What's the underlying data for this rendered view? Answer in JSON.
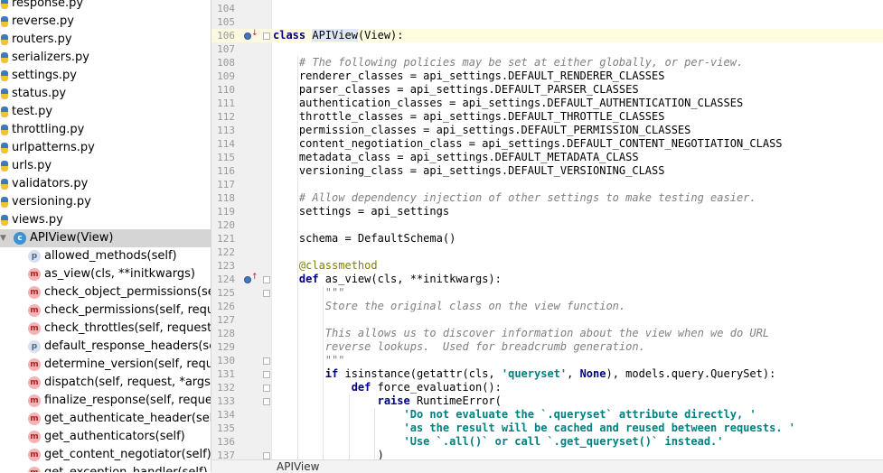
{
  "project_tree": {
    "files": [
      "response.py",
      "reverse.py",
      "routers.py",
      "serializers.py",
      "settings.py",
      "status.py",
      "test.py",
      "throttling.py",
      "urlpatterns.py",
      "urls.py",
      "validators.py",
      "versioning.py",
      "views.py"
    ],
    "class_node": {
      "badge": "c",
      "label": "APIView(View)"
    },
    "members": [
      {
        "badge": "p",
        "label": "allowed_methods(self)"
      },
      {
        "badge": "m",
        "label": "as_view(cls, **initkwargs)"
      },
      {
        "badge": "m",
        "label": "check_object_permissions(sel"
      },
      {
        "badge": "m",
        "label": "check_permissions(self, reque"
      },
      {
        "badge": "m",
        "label": "check_throttles(self, request)"
      },
      {
        "badge": "p",
        "label": "default_response_headers(sel"
      },
      {
        "badge": "m",
        "label": "determine_version(self, reque"
      },
      {
        "badge": "m",
        "label": "dispatch(self, request, *args,"
      },
      {
        "badge": "m",
        "label": "finalize_response(self, reques"
      },
      {
        "badge": "m",
        "label": "get_authenticate_header(self,"
      },
      {
        "badge": "m",
        "label": "get_authenticators(self)"
      },
      {
        "badge": "m",
        "label": "get_content_negotiator(self)"
      },
      {
        "badge": "m",
        "label": "get_exception_handler(self)"
      }
    ]
  },
  "editor": {
    "line_numbers": [
      "104",
      "105",
      "106",
      "107",
      "108",
      "109",
      "110",
      "111",
      "112",
      "113",
      "114",
      "115",
      "116",
      "117",
      "118",
      "119",
      "120",
      "121",
      "122",
      "123",
      "124",
      "125",
      "126",
      "127",
      "128",
      "129",
      "130",
      "131",
      "132",
      "133",
      "134",
      "135",
      "136",
      "137"
    ],
    "lines": {
      "l106_kw": "class ",
      "l106_name": "APIView",
      "l106_rest": "(View):",
      "l108": "    # The following policies may be set at either globally, or per-view.",
      "l109": "    renderer_classes = api_settings.DEFAULT_RENDERER_CLASSES",
      "l110": "    parser_classes = api_settings.DEFAULT_PARSER_CLASSES",
      "l111": "    authentication_classes = api_settings.DEFAULT_AUTHENTICATION_CLASSES",
      "l112": "    throttle_classes = api_settings.DEFAULT_THROTTLE_CLASSES",
      "l113": "    permission_classes = api_settings.DEFAULT_PERMISSION_CLASSES",
      "l114": "    content_negotiation_class = api_settings.DEFAULT_CONTENT_NEGOTIATION_CLASS",
      "l115": "    metadata_class = api_settings.DEFAULT_METADATA_CLASS",
      "l116": "    versioning_class = api_settings.DEFAULT_VERSIONING_CLASS",
      "l118": "    # Allow dependency injection of other settings to make testing easier.",
      "l119": "    settings = api_settings",
      "l121": "    schema = DefaultSchema()",
      "l123": "    @classmethod",
      "l124_kw": "    def ",
      "l124_rest": "as_view(cls, **initkwargs):",
      "l125": "        \"\"\"",
      "l126": "        Store the original class on the view function.",
      "l128": "        This allows us to discover information about the view when we do URL",
      "l129": "        reverse lookups.  Used for breadcrumb generation.",
      "l130": "        \"\"\"",
      "l131_kw": "        if ",
      "l131_a": "isinstance(getattr(cls, ",
      "l131_str": "'queryset'",
      "l131_b": ", ",
      "l131_none": "None",
      "l131_c": "), models.query.QuerySet):",
      "l132_kw": "            def ",
      "l132_rest": "force_evaluation():",
      "l133_kw": "                raise ",
      "l133_rest": "RuntimeError(",
      "l134": "                    'Do not evaluate the `.queryset` attribute directly, '",
      "l135": "                    'as the result will be cached and reused between requests. '",
      "l136": "                    'Use `.all()` or call `.get_queryset()` instead.'",
      "l137": "                )"
    }
  },
  "breadcrumb": "APIView"
}
